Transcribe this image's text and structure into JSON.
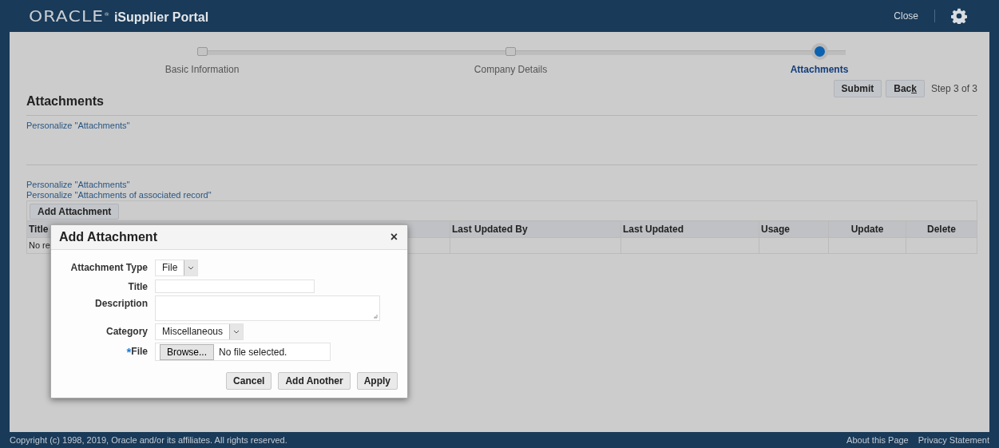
{
  "header": {
    "logo": "ORACLE",
    "logo_mark": "®",
    "product": "iSupplier Portal",
    "close": "Close"
  },
  "train": {
    "steps": [
      {
        "label": "Basic Information",
        "selected": false
      },
      {
        "label": "Company Details",
        "selected": false
      },
      {
        "label": "Attachments",
        "selected": true
      }
    ]
  },
  "actions": {
    "buttons": [
      {
        "label": "Submit"
      },
      {
        "label": "Back",
        "last_letter_underlined": true
      }
    ],
    "step_text": "Step 3 of 3"
  },
  "section": {
    "title": "Attachments",
    "link": "Personalize \"Attachments\""
  },
  "links": [
    "Personalize \"Attachments\"",
    "Personalize \"Attachments of associated record\""
  ],
  "table": {
    "add_button": "Add Attachment",
    "columns": [
      "Title",
      "Last Updated By",
      "Last Updated",
      "Usage",
      "Update",
      "Delete"
    ],
    "rows": [
      [
        "No re",
        "",
        "",
        "",
        "",
        ""
      ]
    ]
  },
  "dialog": {
    "title": "Add Attachment",
    "close": "×",
    "fields": [
      {
        "label": "Attachment Type",
        "kind": "select",
        "value": "File"
      },
      {
        "label": "Title",
        "kind": "text"
      },
      {
        "label": "Description",
        "kind": "textarea"
      },
      {
        "label": "Category",
        "kind": "select",
        "value": "Miscellaneous"
      },
      {
        "label": "File",
        "kind": "file",
        "button": "Browse...",
        "value": "No file selected.",
        "required_mark": "*"
      }
    ],
    "buttons": [
      "Cancel",
      "Add Another",
      "Apply"
    ]
  },
  "footer": {
    "copyright": "Copyright (c) 1998, 2019, Oracle and/or its affiliates. All rights reserved.",
    "links": [
      "About this Page",
      "Privacy Statement"
    ]
  }
}
